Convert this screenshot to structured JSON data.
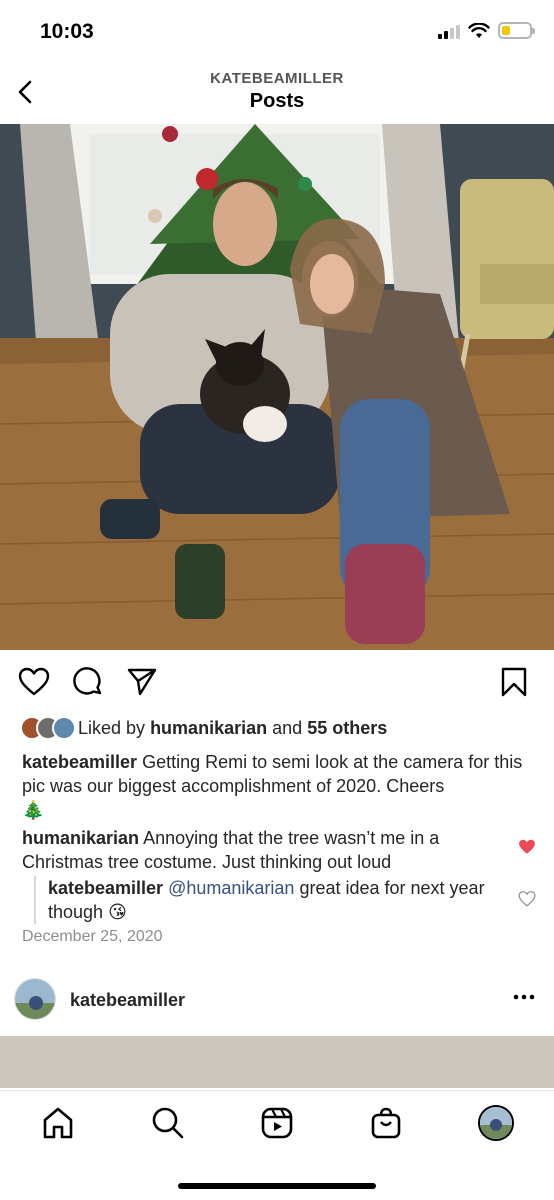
{
  "status": {
    "time": "10:03"
  },
  "header": {
    "username": "KATEBEAMILLER",
    "title": "Posts"
  },
  "post": {
    "likes": {
      "prefix": "Liked by",
      "user": "humanikarian",
      "and": "and",
      "others": "55 others"
    },
    "caption": {
      "user": "katebeamiller",
      "text": "Getting Remi to semi look at the camera for this pic was our biggest accomplishment of 2020. Cheers",
      "emoji": "🎄"
    },
    "comment": {
      "user": "humanikarian",
      "text": "Annoying that the tree wasn’t me in a Christmas tree costume. Just thinking out loud",
      "liked": true
    },
    "reply": {
      "user": "katebeamiller",
      "mention": "@humanikarian",
      "text": "great idea for next year though",
      "emoji": "😘",
      "liked": false
    },
    "date": "December 25, 2020"
  },
  "next_post": {
    "username": "katebeamiller"
  },
  "icons": {
    "back": "chevron-left-icon",
    "like": "heart-icon",
    "comment": "comment-icon",
    "share": "send-icon",
    "save": "bookmark-icon",
    "more": "more-icon",
    "home": "home-icon",
    "search": "search-icon",
    "reels": "reels-icon",
    "shop": "shop-icon"
  },
  "colors": {
    "liked_heart": "#ed4956",
    "mention": "#385185",
    "battery": "#f4c800"
  }
}
